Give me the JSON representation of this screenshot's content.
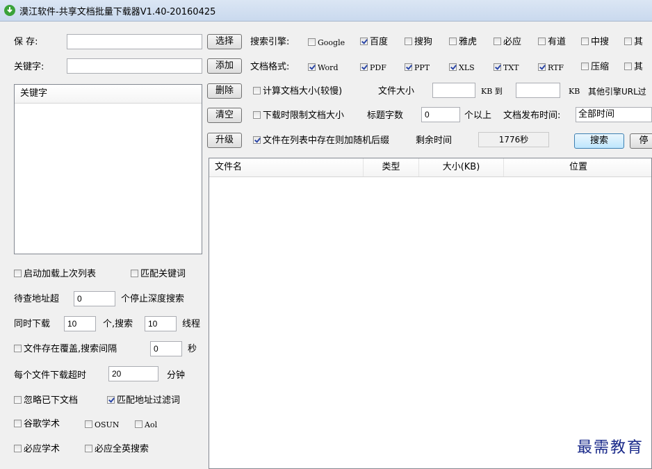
{
  "window": {
    "title": "漠江软件-共享文档批量下载器V1.40-20160425"
  },
  "left": {
    "save_label": "保  存:",
    "save_value": "",
    "keyword_label": "关键字:",
    "keyword_value": "",
    "keyword_list_header": "关键字",
    "opt_load_last": "启动加载上次列表",
    "opt_match_keyword": "匹配关键词",
    "pending_prefix": "待查地址超",
    "pending_value": "0",
    "pending_suffix": "个停止深度搜索",
    "concurrent_prefix": "同时下载",
    "concurrent_value": "10",
    "concurrent_mid": "个,搜索",
    "search_threads_value": "10",
    "concurrent_suffix": "线程",
    "opt_overwrite": "文件存在覆盖,搜索间隔",
    "interval_value": "0",
    "interval_unit": "秒",
    "timeout_prefix": "每个文件下载超时",
    "timeout_value": "20",
    "timeout_unit": "分钟",
    "opt_ignore_downloaded": "忽略已下文档",
    "opt_match_url_filter": "匹配地址过滤词",
    "opt_google_scholar": "谷歌学术",
    "opt_osun": "OSUN",
    "opt_aol": "Aol",
    "opt_bing_scholar": "必应学术",
    "opt_bing_all_english": "必应全英搜索"
  },
  "buttons": {
    "select": "选择",
    "add": "添加",
    "delete": "删除",
    "clear": "清空",
    "upgrade": "升级",
    "search": "搜索",
    "stop": "停"
  },
  "engines": {
    "label": "搜索引擎:",
    "items": [
      {
        "name": "Google",
        "checked": false
      },
      {
        "name": "百度",
        "checked": true
      },
      {
        "name": "搜狗",
        "checked": false
      },
      {
        "name": "雅虎",
        "checked": false
      },
      {
        "name": "必应",
        "checked": false
      },
      {
        "name": "有道",
        "checked": false
      },
      {
        "name": "中搜",
        "checked": false
      },
      {
        "name": "其",
        "checked": false
      }
    ]
  },
  "formats": {
    "label": "文档格式:",
    "items": [
      {
        "name": "Word",
        "checked": true
      },
      {
        "name": "PDF",
        "checked": true
      },
      {
        "name": "PPT",
        "checked": true
      },
      {
        "name": "XLS",
        "checked": true
      },
      {
        "name": "TXT",
        "checked": true
      },
      {
        "name": "RTF",
        "checked": true
      },
      {
        "name": "压缩",
        "checked": false
      },
      {
        "name": "其",
        "checked": false
      }
    ]
  },
  "size_row": {
    "opt_calc_size": "计算文档大小(较慢)",
    "size_label": "文件大小",
    "size_min": "",
    "unit1": "KB 到",
    "size_max": "",
    "unit2": "KB",
    "other_engines": "其他引擎URL过"
  },
  "limit_row": {
    "opt_limit_size": "下载时限制文档大小",
    "title_chars_label": "标题字数",
    "title_chars_value": "0",
    "title_chars_suffix": "个以上",
    "publish_time_label": "文档发布时间:",
    "publish_time_value": "全部时间"
  },
  "random_row": {
    "opt_random_suffix": "文件在列表中存在则加随机后缀",
    "remaining_label": "剩余时间",
    "remaining_value": "1776秒"
  },
  "results": {
    "columns": [
      "文件名",
      "类型",
      "大小(KB)",
      "位置"
    ]
  },
  "watermark": "最需教育"
}
